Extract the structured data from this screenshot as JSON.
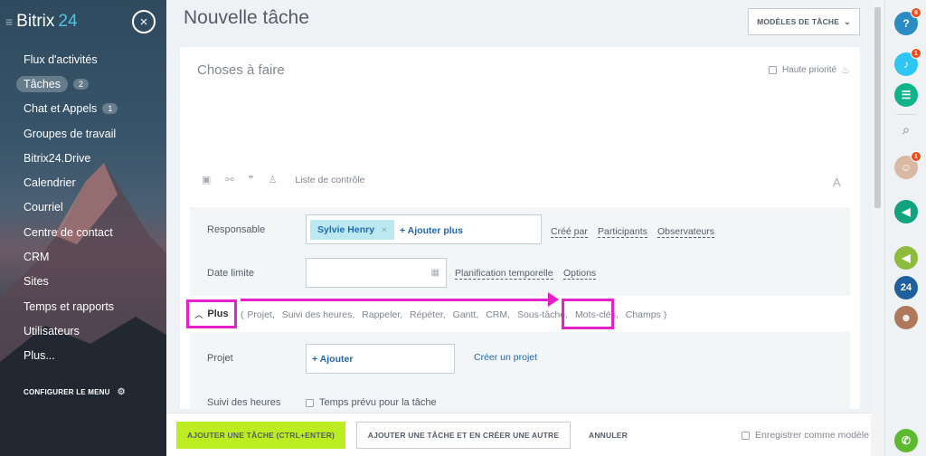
{
  "sidebar": {
    "logo_text": "Bitrix",
    "logo_number": "24",
    "close_icon": "×",
    "items": [
      {
        "label": "Flux d'activités",
        "badge": ""
      },
      {
        "label": "Tâches",
        "badge": "2"
      },
      {
        "label": "Chat et Appels",
        "badge": "1"
      },
      {
        "label": "Groupes de travail",
        "badge": ""
      },
      {
        "label": "Bitrix24.Drive",
        "badge": ""
      },
      {
        "label": "Calendrier",
        "badge": ""
      },
      {
        "label": "Courriel",
        "badge": ""
      },
      {
        "label": "Centre de contact",
        "badge": ""
      },
      {
        "label": "CRM",
        "badge": ""
      },
      {
        "label": "Sites",
        "badge": ""
      },
      {
        "label": "Temps et rapports",
        "badge": ""
      },
      {
        "label": "Utilisateurs",
        "badge": ""
      },
      {
        "label": "Plus...",
        "badge": ""
      }
    ],
    "configure_label": "CONFIGURER LE MENU"
  },
  "header": {
    "title": "Nouvelle tâche",
    "templates_button": "MODÈLES DE TÂCHE"
  },
  "task": {
    "title_placeholder": "Choses à faire",
    "high_priority_label": "Haute priorité",
    "checklist_label": "Liste de contrôle",
    "font_icon": "A"
  },
  "fields": {
    "responsible_label": "Responsable",
    "responsible_chip": "Sylvie Henry",
    "add_more": "+ Ajouter plus",
    "created_by": "Créé par",
    "participants": "Participants",
    "observers": "Observateurs",
    "deadline_label": "Date limite",
    "time_planning": "Planification temporelle",
    "options": "Options",
    "plus_label": "Plus",
    "extras": [
      "Projet,",
      "Suivi des heures,",
      "Rappeler,",
      "Répéter,",
      "Gantt,",
      "CRM,",
      "Sous-tâche,",
      "Mots-clés,",
      "Champs )"
    ],
    "extras_open": "(",
    "project_label": "Projet",
    "project_add": "+ Ajouter",
    "create_project": "Créer un projet",
    "time_tracking_label": "Suivi des heures",
    "planned_time_label": "Temps prévu pour la tâche"
  },
  "footer": {
    "add_task": "AJOUTER UNE TÂCHE (CTRL+ENTER)",
    "add_and_create": "AJOUTER UNE TÂCHE ET EN CRÉER UNE AUTRE",
    "cancel": "ANNULER",
    "save_template": "Enregistrer comme modèle"
  },
  "right_panel": {
    "help_badge": "8",
    "notif_badge": "1",
    "contacts_badge": "1",
    "calendar_24": "24"
  },
  "colors": {
    "accent_green": "#bbed21",
    "link_blue": "#2067b0",
    "highlight_magenta": "#e621c7",
    "chip_bg": "#bce8f1"
  }
}
